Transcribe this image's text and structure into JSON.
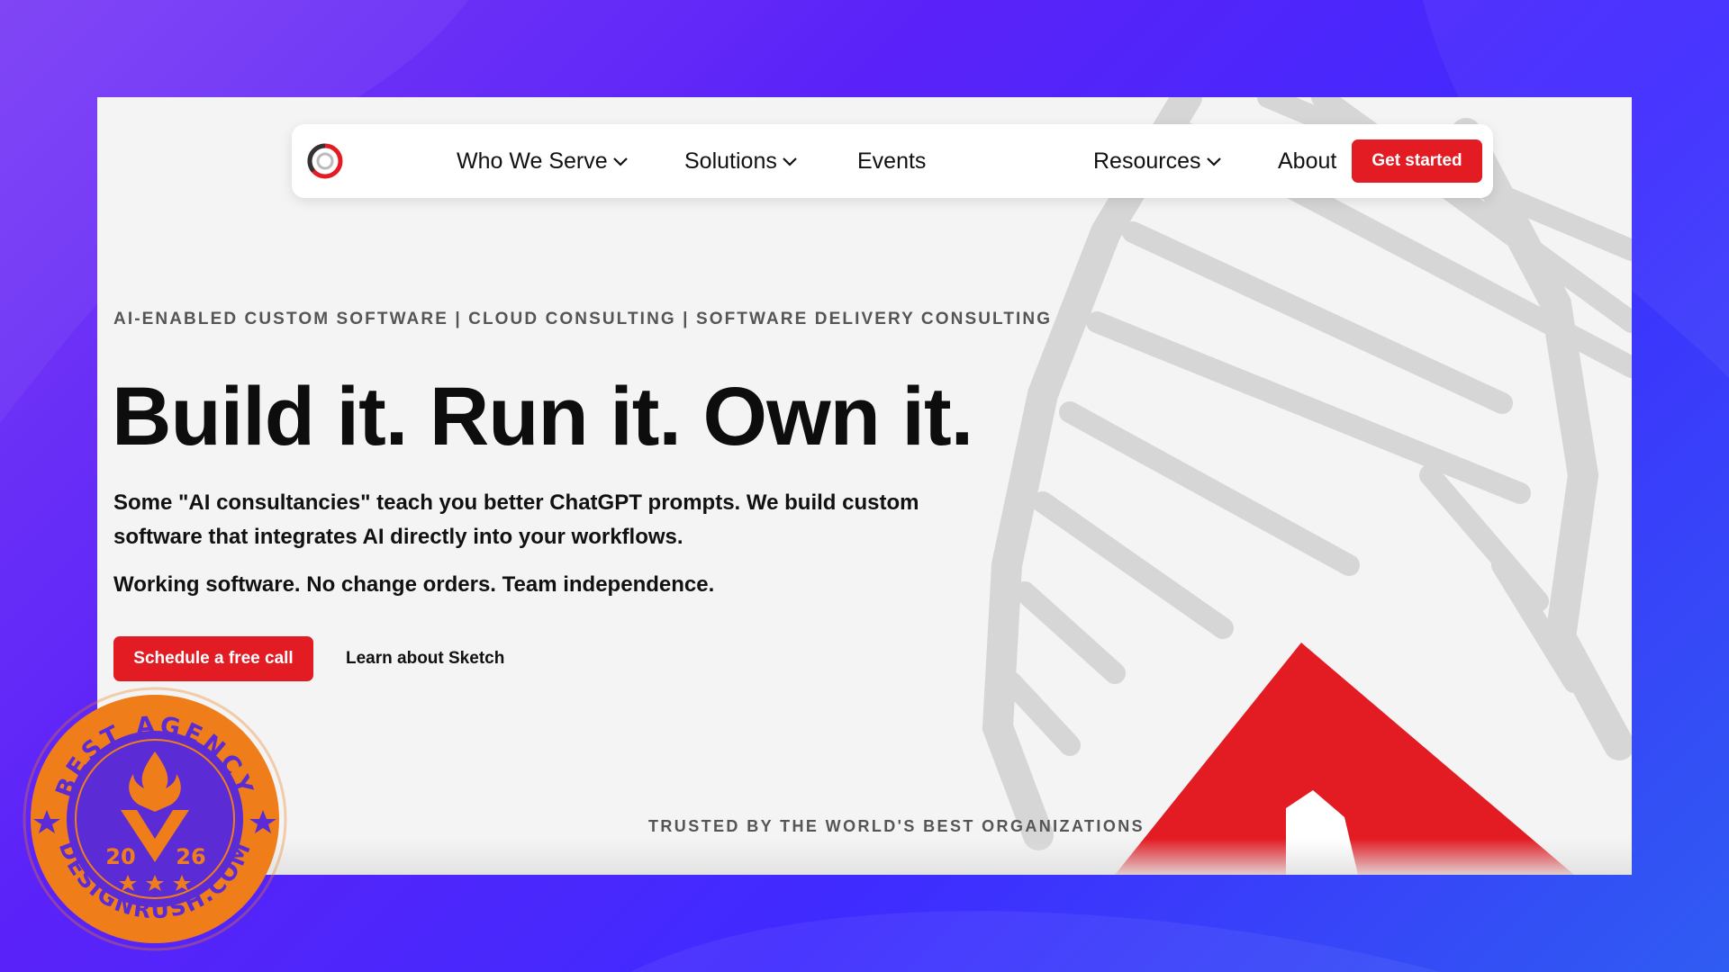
{
  "nav": {
    "items": [
      {
        "label": "Who We Serve",
        "has_dropdown": true
      },
      {
        "label": "Solutions",
        "has_dropdown": true
      },
      {
        "label": "Events",
        "has_dropdown": false
      },
      {
        "label": "Resources",
        "has_dropdown": true
      },
      {
        "label": "About",
        "has_dropdown": false
      }
    ],
    "cta_label": "Get started"
  },
  "hero": {
    "eyebrow": "AI-ENABLED CUSTOM SOFTWARE | CLOUD CONSULTING | SOFTWARE DELIVERY CONSULTING",
    "headline": "Build it. Run it. Own it.",
    "lede": "Some \"AI consultancies\" teach you better ChatGPT prompts. We build custom software that integrates AI directly into your workflows.",
    "tagline": "Working software. No change orders. Team independence.",
    "primary_cta": "Schedule a free call",
    "secondary_cta": "Learn about Sketch"
  },
  "trusted_label": "TRUSTED BY THE WORLD'S BEST ORGANIZATIONS",
  "badge": {
    "top_text": "BEST AGENCY",
    "bottom_text": "DESIGNRUSH.COM",
    "year_left": "20",
    "year_right": "26"
  },
  "colors": {
    "brand_red": "#e31c24",
    "badge_orange": "#ef7d1a",
    "badge_purple": "#5b2bd6",
    "background_purple": "#5a22f8",
    "page_bg": "#f4f4f4"
  },
  "icons": {
    "logo": "brand-ring-logo",
    "dropdown": "chevron-down-icon",
    "badge_flame": "flame-icon",
    "badge_star": "star-icon"
  }
}
